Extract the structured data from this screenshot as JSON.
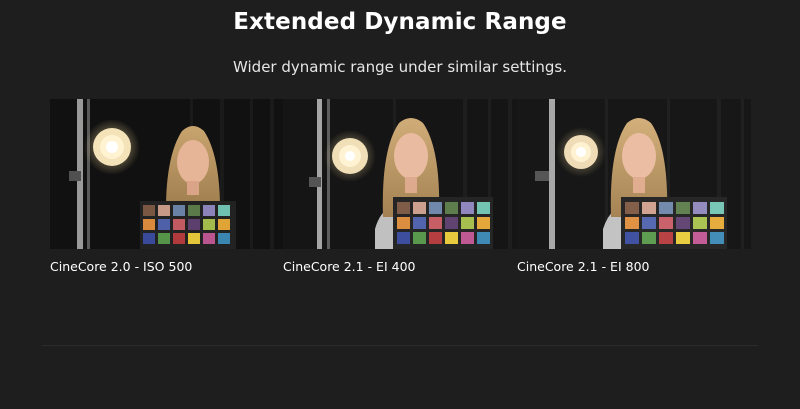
{
  "header": {
    "title": "Extended Dynamic Range",
    "subtitle": "Wider dynamic range under similar settings."
  },
  "comparison": {
    "items": [
      {
        "caption": "CineCore 2.0 - ISO 500"
      },
      {
        "caption": "CineCore 2.1 - EI 400"
      },
      {
        "caption": "CineCore 2.1 - EI 800"
      }
    ]
  },
  "colors": {
    "background": "#1e1e1e",
    "text": "#ffffff",
    "lamp": "#fff1cc"
  }
}
